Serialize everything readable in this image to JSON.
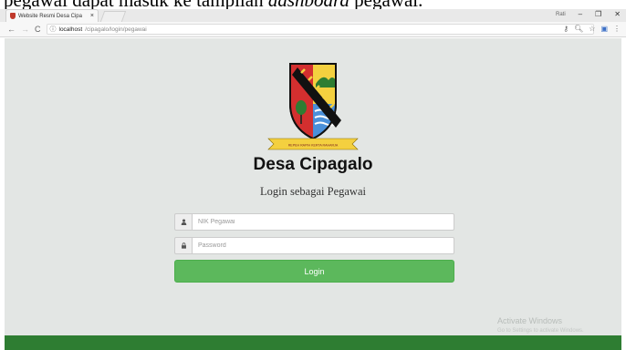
{
  "caption": {
    "text": "pegawai dapat masuk ke tampilan ",
    "italic": "dashboard",
    "tail": " pegawai."
  },
  "browser": {
    "tab_title": "Website Resmi Desa Cipa",
    "tab_close": "×",
    "user_label": "Rati",
    "url_host": "localhost",
    "url_path": "/cipagalo/login/pegawai"
  },
  "page": {
    "motto": "REPEH RAPIH KERTA RAHARJA",
    "brand": "Desa Cipagalo",
    "subtitle": "Login sebagai Pegawai",
    "nik": {
      "placeholder": "NIK Pegawai",
      "value": ""
    },
    "password": {
      "placeholder": "Password",
      "value": ""
    },
    "login_button": "Login",
    "watermark_title": "Activate Windows",
    "watermark_sub": "Go to Settings to activate Windows."
  },
  "colors": {
    "page_bg": "#e3e6e4",
    "button": "#5cb85c",
    "footer": "#2e7d32",
    "shield_red": "#d32f2f",
    "shield_yellow": "#f4d03f",
    "shield_green": "#2e7d32",
    "shield_blue": "#4a90d9"
  },
  "icons": {
    "nik": "user-icon",
    "password": "lock-icon"
  }
}
